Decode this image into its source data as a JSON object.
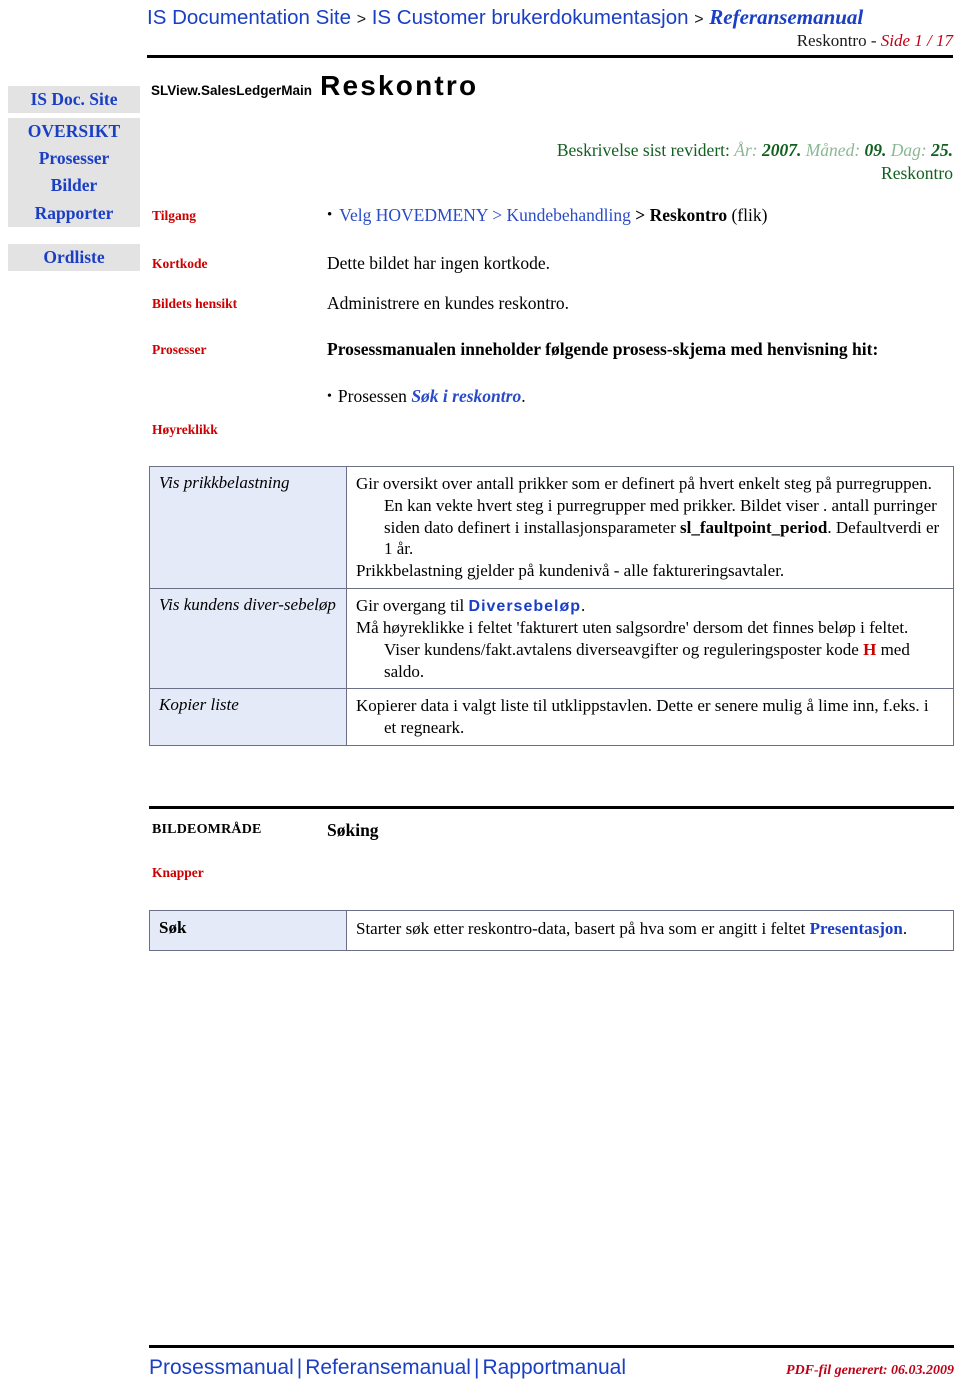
{
  "header": {
    "breadcrumb": [
      {
        "label": "IS Documentation Site",
        "style": "link"
      },
      {
        "label": ">",
        "style": "sep"
      },
      {
        "label": "IS Customer brukerdokumentasjon",
        "style": "link"
      },
      {
        "label": ">",
        "style": "sep"
      },
      {
        "label": "Referansemanual",
        "style": "italic-link"
      }
    ],
    "doc_name": "Reskontro",
    "dash": " - ",
    "page_label": "Side 1 / 17"
  },
  "sidebar": {
    "items": [
      {
        "label": "IS Doc. Site"
      },
      {
        "label": "OVERSIKT"
      },
      {
        "label": "Prosesser"
      },
      {
        "label": "Bilder"
      },
      {
        "label": "Rapporter"
      },
      {
        "label": "Ordliste"
      }
    ]
  },
  "title": {
    "code": "SLView.SalesLedgerMain",
    "name": "Reskontro"
  },
  "revision": {
    "prefix": "Beskrivelse sist revidert:",
    "year_label": "År:",
    "year_value": "2007.",
    "month_label": "Måned:",
    "month_value": "09.",
    "day_label": "Dag:",
    "day_value": "25.",
    "subject": "Reskontro"
  },
  "info": {
    "tilgang_label": "Tilgang",
    "tilgang_path_blue": "Velg HOVEDMENY > Kundebehandling ",
    "tilgang_gt": "> ",
    "tilgang_bold": "Reskontro",
    "tilgang_suffix": " (flik)",
    "kortkode_label": "Kortkode",
    "kortkode_value": "Dette bildet har ingen kortkode.",
    "hensikt_label": "Bildets hensikt",
    "hensikt_value": "Administrere en kundes reskontro.",
    "prosesser_label": "Prosesser",
    "prosesser_heading": "Prosessmanualen inneholder følgende prosess-skjema med henvisning hit:",
    "prosesser_item_prefix": "Prosessen ",
    "prosesser_item_link": "Søk i reskontro",
    "prosesser_item_suffix": "."
  },
  "hoyreklikk": {
    "label": "Høyreklikk",
    "rows": [
      {
        "name": "Vis prikkbelastning",
        "lines": [
          {
            "text": "Gir oversikt over antall prikker som er definert på hvert enkelt steg på purregruppen. En kan vekte hvert steg i purregrupper med prikker. Bildet viser . antall purringer siden dato definert i installasjonsparameter ",
            "hang": true
          },
          {
            "bold": "sl_faultpoint_period"
          },
          {
            "text": ". Defaultverdi er 1 år."
          },
          {
            "text": "Prikkbelastning gjelder på kundenivå - alle faktureringsavtaler.",
            "newline": true
          }
        ]
      },
      {
        "name": "Vis kundens diver-sebeløp",
        "line1_prefix": "Gir overgang til ",
        "line1_link": "Diversebeløp",
        "line1_suffix": ".",
        "line2a": "Må høyreklikke i feltet 'fakturert uten salgsordre' dersom det finnes beløp i feltet. Viser kundens/fakt.avtalens diverseavgifter og reguleringsposter kode ",
        "line2_code": "H",
        "line2b": " med saldo."
      },
      {
        "name": "Kopier liste",
        "text": "Kopierer data i valgt liste til utklippstavlen. Dette er senere mulig å lime inn, f.eks. i et regneark."
      }
    ]
  },
  "section": {
    "bildeomrade_label": "BILDEOMRÅDE",
    "bildeomrade_value": "Søking",
    "knapper_label": "Knapper"
  },
  "buttons": {
    "rows": [
      {
        "name": "Søk",
        "prefix": "Starter søk etter reskontro-data, basert på hva som er angitt i feltet ",
        "link": "Presentasjon",
        "suffix": "."
      }
    ]
  },
  "footer": {
    "links": [
      "Prosessmanual",
      "Referansemanual",
      "Rapportmanual"
    ],
    "separator": "|",
    "pdf_note": "PDF-fil generert: 06.03.2009"
  },
  "colors": {
    "link_blue": "#1a3fc4",
    "label_red": "#cc0000",
    "revision_green": "#12601f",
    "cell_fill": "#e4eaf7",
    "sidebar_fill": "#e3e3e3"
  }
}
